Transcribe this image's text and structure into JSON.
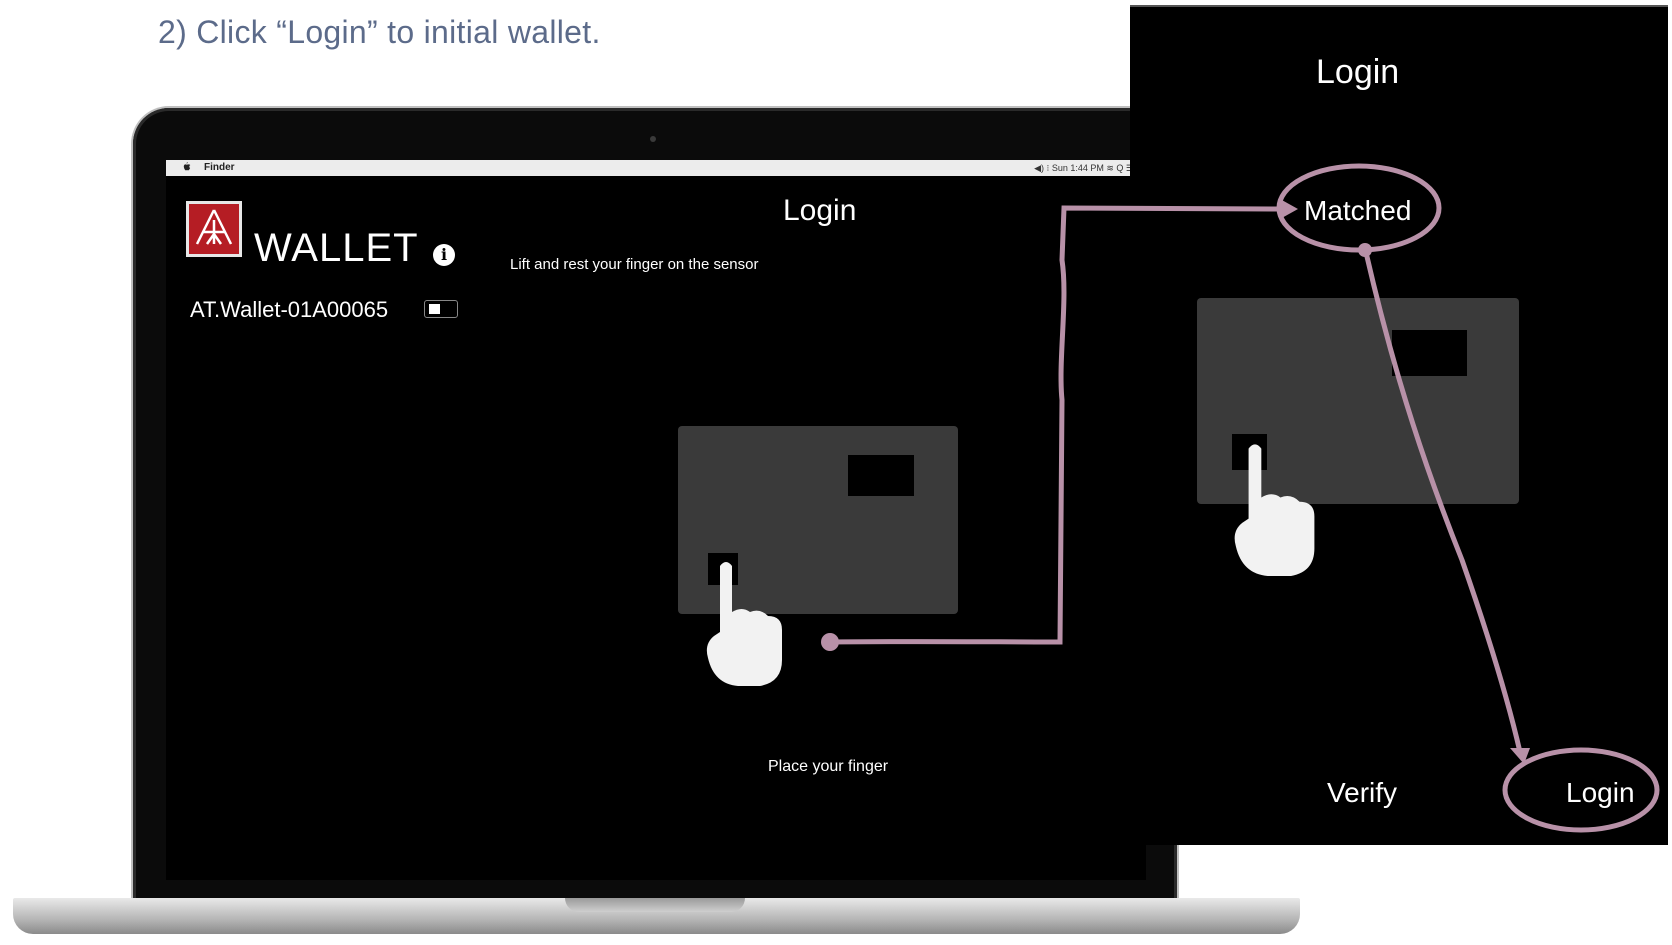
{
  "instruction": "2)    Click “Login” to initial wallet.",
  "laptop": {
    "menubar": {
      "app": "Finder",
      "status": "◀)   ⁝   Sun 1:44 PM   ≋   Q   ☰"
    },
    "app_name": "WALLET",
    "info_icon": "i",
    "device_name": "AT.Wallet-01A00065",
    "title": "Login",
    "hint": "Lift and rest your finger on the sensor",
    "status": "Place your finger"
  },
  "phone": {
    "title": "Login",
    "status": "Matched",
    "verify_label": "Verify",
    "login_label": "Login"
  },
  "colors": {
    "annotation": "#b891a8",
    "logo_red": "#b51d24",
    "instruction_text": "#5c6b8a"
  }
}
